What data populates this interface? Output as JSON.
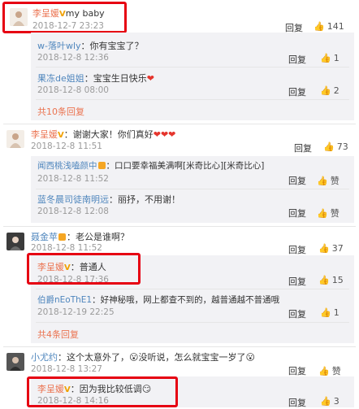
{
  "colors": {
    "accent": "#eb7350",
    "blue": "#4f86bd",
    "red_highlight": "#e60012",
    "heart": "#e5352d"
  },
  "icons": {
    "like": "thumbs-up-icon",
    "vip": "vip-badge-icon",
    "reply_arrow": "reply-icon"
  },
  "c1": {
    "name": "李呈媛",
    "content": "my baby",
    "time": "2018-12-7 23:23",
    "reply": "回复",
    "likes": "141",
    "replies": [
      {
        "name": "w-落叶wly",
        "content": "：你有宝宝了？",
        "time": "2018-12-8 12:36",
        "reply": "回复",
        "likes": "1"
      },
      {
        "name": "果冻de姐姐",
        "content": "：宝宝生日快乐",
        "time": "2018-12-8 08:00",
        "reply": "回复",
        "likes": "2"
      }
    ],
    "more": "共10条回复"
  },
  "c2": {
    "name": "李呈媛",
    "content": "：谢谢大家！你们真好",
    "time": "2018-12-8 11:51",
    "reply": "回复",
    "likes": "73",
    "replies": [
      {
        "name": "闻西桃浅嗑颜中",
        "content": "：口口要幸福美满啊[米奇比心][米奇比心]",
        "time": "2018-12-8 11:52",
        "reply": "回复",
        "likes": "赞"
      },
      {
        "name": "蓝冬晨司徒南明远",
        "content": "：丽抒，不用谢！",
        "time": "2018-12-8 12:08",
        "reply": "回复",
        "likes": "赞"
      }
    ]
  },
  "c3": {
    "name": "聂金苹",
    "content": "：老公是谁啊？",
    "time": "2018-12-8 11:52",
    "reply": "回复",
    "likes": "37",
    "replies": [
      {
        "name": "李呈媛",
        "content": "：普通人",
        "time": "2018-12-8 17:36",
        "reply": "回复",
        "likes": "15"
      },
      {
        "name": "伯爵nEoThE1",
        "content": "：好神秘哦，网上都查不到的，越普通越不普通哦",
        "time": "2018-12-19 22:25",
        "reply": "回复",
        "likes": "1"
      }
    ],
    "more": "共4条回复"
  },
  "c4": {
    "name": "小尤约",
    "content": "：这个太意外了，",
    "content2": "没听说，怎么就宝宝一岁了",
    "time": "2018-12-8 13:27",
    "reply": "回复",
    "likes": "赞",
    "replies": [
      {
        "name": "李呈媛",
        "content": "：因为我比较低调",
        "time": "2018-12-8 14:16",
        "reply": "回复",
        "likes": "3"
      }
    ]
  }
}
